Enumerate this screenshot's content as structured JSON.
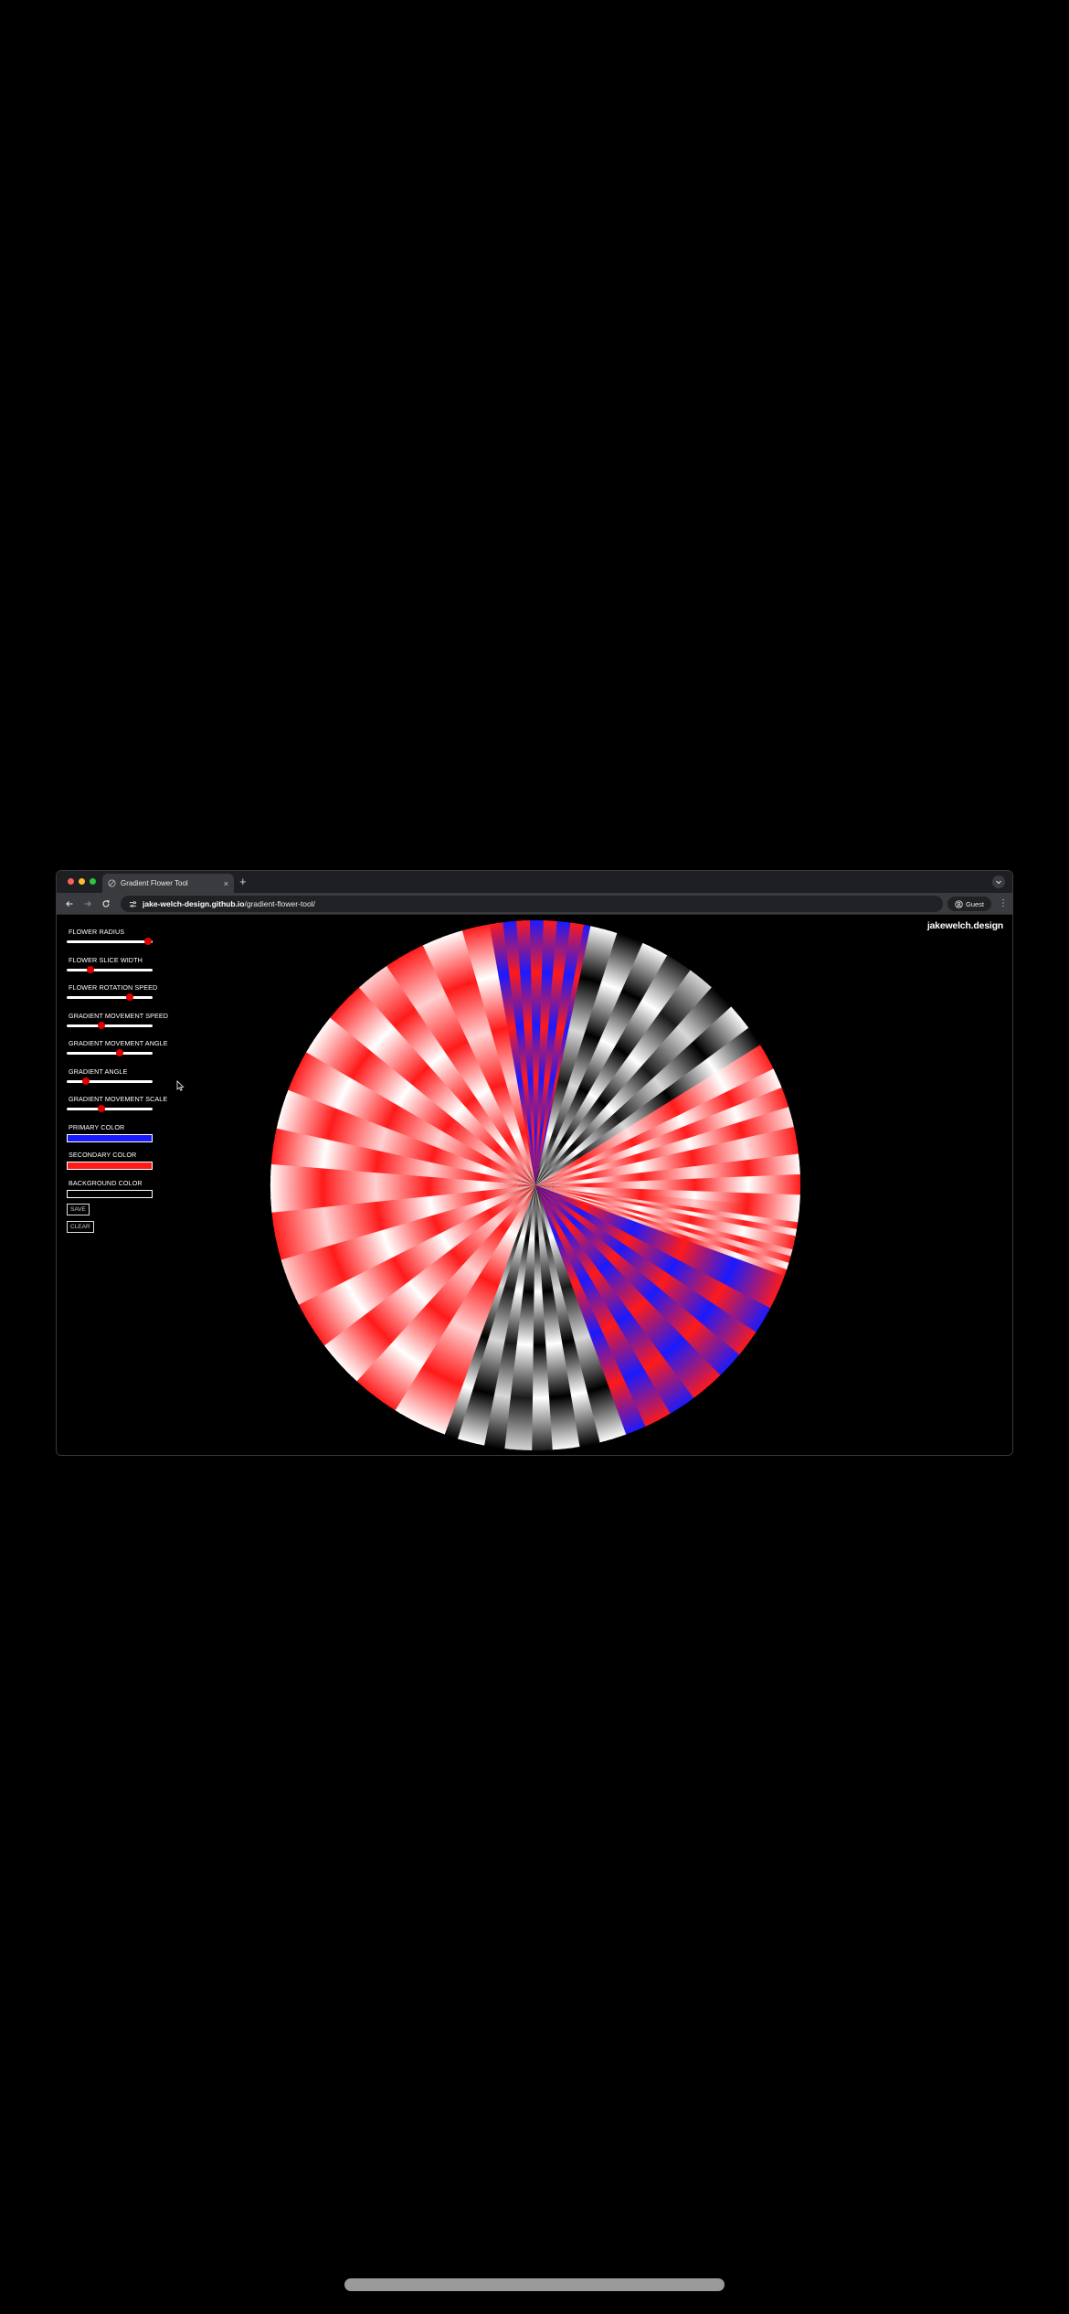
{
  "browser": {
    "tab_title": "Gradient Flower Tool",
    "tab_close": "×",
    "new_tab": "+",
    "url_host": "jake-welch-design.github.io",
    "url_path": "/gradient-flower-tool/",
    "profile_label": "Guest",
    "menu_glyph": "⋮"
  },
  "page": {
    "brand": "jakewelch.design"
  },
  "controls": {
    "sliders": [
      {
        "label": "FLOWER RADIUS",
        "value": 0.95
      },
      {
        "label": "FLOWER SLICE WIDTH",
        "value": 0.28
      },
      {
        "label": "FLOWER ROTATION SPEED",
        "value": 0.73
      },
      {
        "label": "GRADIENT MOVEMENT SPEED",
        "value": 0.4
      },
      {
        "label": "GRADIENT MOVEMENT ANGLE",
        "value": 0.62
      },
      {
        "label": "GRADIENT ANGLE",
        "value": 0.22
      },
      {
        "label": "GRADIENT MOVEMENT SCALE",
        "value": 0.4
      }
    ],
    "colors": [
      {
        "label": "PRIMARY COLOR",
        "value": "#1a1aff"
      },
      {
        "label": "SECONDARY COLOR",
        "value": "#ff1a1a"
      },
      {
        "label": "BACKGROUND COLOR",
        "value": "#000000"
      }
    ],
    "save_label": "SAVE",
    "clear_label": "CLEAR"
  },
  "flower": {
    "primary_color": "#1a1aff",
    "secondary_color": "#ff1a1a",
    "background_color": "#000000",
    "petals": [
      {
        "start": -78,
        "end": -10,
        "scheme": "red-white"
      },
      {
        "start": -10,
        "end": 12,
        "scheme": "blue-red"
      },
      {
        "start": 12,
        "end": 58,
        "scheme": "gray"
      },
      {
        "start": 58,
        "end": 95,
        "scheme": "white-red"
      },
      {
        "start": 95,
        "end": 110,
        "scheme": "red-white"
      },
      {
        "start": 110,
        "end": 160,
        "scheme": "blue-red"
      },
      {
        "start": 160,
        "end": 200,
        "scheme": "gray"
      },
      {
        "start": 200,
        "end": 282,
        "scheme": "red-white"
      }
    ]
  },
  "icons": {
    "favicon": "favicon-icon",
    "back": "back-arrow-icon",
    "forward": "forward-arrow-icon",
    "reload": "reload-icon",
    "site_info": "site-settings-icon",
    "profile": "profile-icon",
    "chevron": "chevron-down-icon",
    "cursor": "mouse-pointer-icon"
  }
}
